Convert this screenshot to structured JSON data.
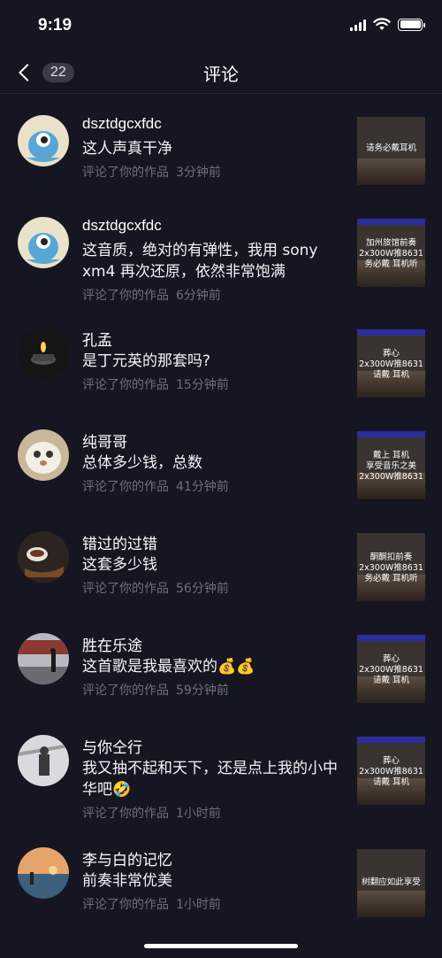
{
  "status": {
    "time": "9:19"
  },
  "header": {
    "back_count": "22",
    "title": "评论"
  },
  "comments": [
    {
      "user": "dsztdgcxfdc",
      "text": "这人声真干净",
      "action": "评论了你的作品",
      "when": "3分钟前",
      "thumb": "请务必戴耳机"
    },
    {
      "user": "dsztdgcxfdc",
      "text": "这音质，绝对的有弹性，我用 sony xm4 再次还原，依然非常饱满",
      "action": "评论了你的作品",
      "when": "6分钟前",
      "thumb": "加州旅馆前奏\n2x300W推8631\n务必戴  耳机听"
    },
    {
      "user": "孔孟",
      "text": "是丁元英的那套吗?",
      "action": "评论了你的作品",
      "when": "15分钟前",
      "thumb": "葬心\n2x300W推8631\n请戴  耳机"
    },
    {
      "user": "纯哥哥",
      "text": "总体多少钱，总数",
      "action": "评论了你的作品",
      "when": "41分钟前",
      "thumb": "戴上  耳机\n享受音乐之美\n2x300W推8631"
    },
    {
      "user": "错过的过错",
      "text": "这套多少钱",
      "action": "评论了你的作品",
      "when": "56分钟前",
      "thumb": "酮酮扣前奏\n2x300W推8631\n务必戴  耳机听"
    },
    {
      "user": "胜在乐途",
      "text": "这首歌是我最喜欢的💰💰",
      "action": "评论了你的作品",
      "when": "59分钟前",
      "thumb": "葬心\n2x300W推8631\n请戴  耳机"
    },
    {
      "user": "与你仝行",
      "text": "我又抽不起和天下，还是点上我的小中华吧🤣",
      "action": "评论了你的作品",
      "when": "1小时前",
      "thumb": "葬心\n2x300W推8631\n请戴  耳机"
    },
    {
      "user": "李与白的记忆",
      "text": "前奏非常优美",
      "action": "评论了你的作品",
      "when": "1小时前",
      "thumb": "树翻应如此享受"
    }
  ]
}
